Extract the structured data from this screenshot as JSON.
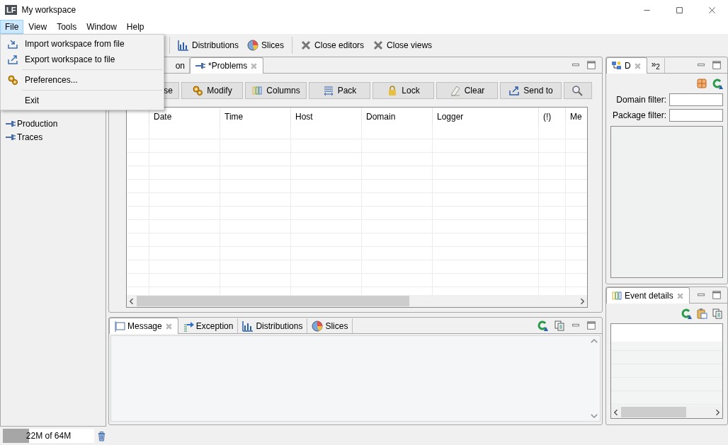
{
  "window": {
    "logo": "LF",
    "title": "My workspace"
  },
  "menu_bar": [
    {
      "label": "File",
      "selected": true
    },
    {
      "label": "View",
      "selected": false
    },
    {
      "label": "Tools",
      "selected": false
    },
    {
      "label": "Window",
      "selected": false
    },
    {
      "label": "Help",
      "selected": false
    }
  ],
  "file_menu": [
    {
      "kind": "item",
      "label": "Import workspace from file"
    },
    {
      "kind": "item",
      "label": "Export workspace to file"
    },
    {
      "kind": "separator"
    },
    {
      "kind": "item",
      "label": "Preferences..."
    },
    {
      "kind": "separator"
    },
    {
      "kind": "item",
      "label": "Exit"
    }
  ],
  "toolbar": [
    {
      "kind": "separator"
    },
    {
      "kind": "button",
      "label": "Distributions"
    },
    {
      "kind": "button",
      "label": "Slices"
    },
    {
      "kind": "separator"
    },
    {
      "kind": "button",
      "label": "Close editors"
    },
    {
      "kind": "button",
      "label": "Close views"
    }
  ],
  "sidebar": {
    "items": [
      {
        "label": "Production",
        "selected": false
      },
      {
        "label": "Traces",
        "selected": false
      }
    ]
  },
  "editor": {
    "tabs": [
      {
        "label": "on",
        "selected": false,
        "closable": false
      },
      {
        "label": "*Problems",
        "selected": true,
        "closable": true
      }
    ],
    "buttons": [
      "se",
      "Modify",
      "Columns",
      "Pack",
      "Lock",
      "Clear",
      "Send to"
    ],
    "table": {
      "columns": [
        "Date",
        "Time",
        "Host",
        "Domain",
        "Logger",
        "(!)",
        "Me"
      ]
    }
  },
  "bottom_panel": {
    "tabs": [
      {
        "label": "Message",
        "selected": true,
        "closable": true
      },
      {
        "label": "Exception",
        "selected": false,
        "closable": false
      },
      {
        "label": "Distributions",
        "selected": false,
        "closable": false
      },
      {
        "label": "Slices",
        "selected": false,
        "closable": false
      }
    ]
  },
  "filter_panel": {
    "tabs": [
      {
        "label": "D",
        "selected": true,
        "closable": true
      },
      {
        "label": "»$_{2}$",
        "selected": false,
        "closable": false
      }
    ],
    "filters": [
      {
        "label": "Domain filter:"
      },
      {
        "label": "Package filter:"
      }
    ]
  },
  "details_panel": {
    "tabs": [
      {
        "label": "Event details",
        "selected": true,
        "closable": true
      }
    ]
  },
  "status_bar": {
    "memory": {
      "reading": "22M of 64M",
      "level": 0.29
    }
  }
}
